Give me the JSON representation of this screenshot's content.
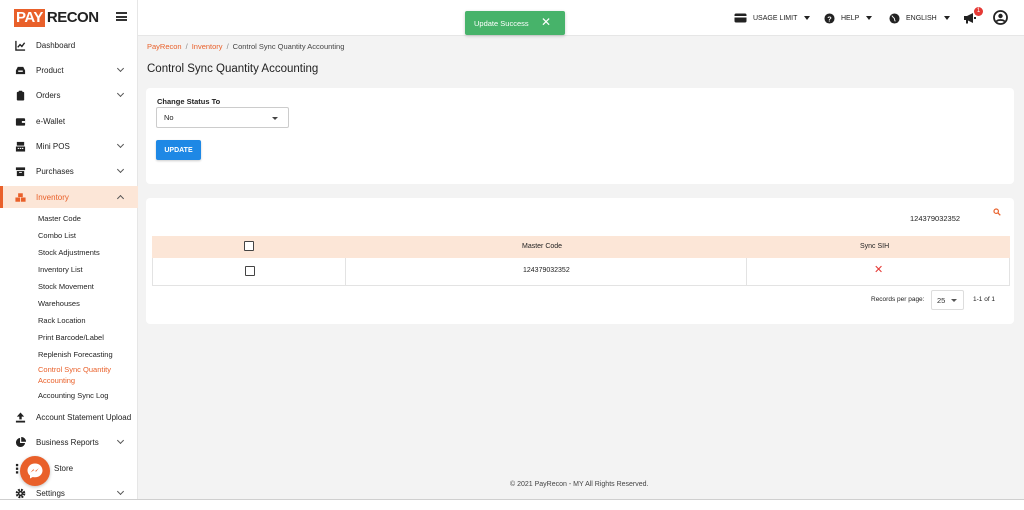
{
  "logo": {
    "pay": "PAY",
    "recon": "RECON"
  },
  "sidebar": {
    "items": [
      {
        "label": "Dashboard",
        "icon": "dashboard-icon"
      },
      {
        "label": "Product",
        "icon": "product-icon",
        "expandable": true
      },
      {
        "label": "Orders",
        "icon": "orders-icon",
        "expandable": true
      },
      {
        "label": "e-Wallet",
        "icon": "wallet-icon"
      },
      {
        "label": "Mini POS",
        "icon": "pos-icon",
        "expandable": true
      },
      {
        "label": "Purchases",
        "icon": "purchases-icon",
        "expandable": true
      },
      {
        "label": "Inventory",
        "icon": "inventory-icon",
        "expandable": true,
        "expanded": true,
        "active": true
      },
      {
        "label": "Account Statement Upload",
        "icon": "upload-icon"
      },
      {
        "label": "Business Reports",
        "icon": "reports-icon",
        "expandable": true
      },
      {
        "label": "Store",
        "icon": "store-icon"
      },
      {
        "label": "Settings",
        "icon": "settings-icon",
        "expandable": true
      }
    ],
    "inventory_sub": [
      "Master Code",
      "Combo List",
      "Stock Adjustments",
      "Inventory List",
      "Stock Movement",
      "Warehouses",
      "Rack Location",
      "Print Barcode/Label",
      "Replenish Forecasting",
      "Control Sync Quantity",
      "Accounting",
      "Accounting Sync Log"
    ]
  },
  "toast": {
    "message": "Update Success",
    "close": "✕",
    "color": "#47b36a"
  },
  "topbar": {
    "usage_limit": "USAGE LIMIT",
    "help": "HELP",
    "language": "ENGLISH",
    "notification_count": "1"
  },
  "breadcrumb": {
    "root": "PayRecon",
    "section": "Inventory",
    "current": "Control Sync Quantity Accounting"
  },
  "page_title": "Control Sync Quantity Accounting",
  "form": {
    "label": "Change Status To",
    "selected": "No",
    "button": "UPDATE"
  },
  "search": {
    "value": "124379032352"
  },
  "table": {
    "headers": [
      "Master Code",
      "Sync SIH"
    ],
    "rows": [
      {
        "master_code": "124379032352",
        "sync_sih": "✕"
      }
    ]
  },
  "pagination": {
    "label": "Records per page:",
    "per_page": "25",
    "range": "1-1 of 1"
  },
  "footer": "© 2021 PayRecon - MY All Rights Reserved.",
  "colors": {
    "accent": "#e9602a",
    "primary_button": "#1e88e5",
    "success": "#47b36a",
    "header_row": "#fce6d7",
    "error": "#e53935"
  }
}
